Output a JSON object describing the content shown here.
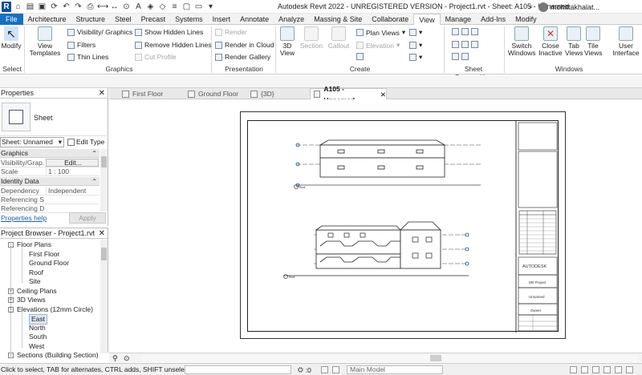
{
  "app": {
    "title": "Autodesk Revit 2022 - UNREGISTERED VERSION - Project1.rvt - Sheet: A105 - Unnamed",
    "user": "mohittakhalat..."
  },
  "ribbon_tabs": [
    "File",
    "Architecture",
    "Structure",
    "Steel",
    "Precast",
    "Systems",
    "Insert",
    "Annotate",
    "Analyze",
    "Massing & Site",
    "Collaborate",
    "View",
    "Manage",
    "Add-Ins",
    "Modify"
  ],
  "active_tab": "View",
  "ribbon": {
    "select": {
      "modify": "Modify",
      "select": "Select"
    },
    "graphics": {
      "label": "Graphics",
      "view_templates": "View Templates",
      "visibility_graphics": "Visibility/ Graphics",
      "filters": "Filters",
      "thin_lines": "Thin Lines",
      "show_hidden_lines": "Show Hidden Lines",
      "remove_hidden_lines": "Remove Hidden Lines",
      "cut_profile": "Cut Profile"
    },
    "presentation": {
      "label": "Presentation",
      "render": "Render",
      "render_in_cloud": "Render in Cloud",
      "render_gallery": "Render Gallery"
    },
    "create": {
      "label": "Create",
      "view_3d": "3D View",
      "section": "Section",
      "callout": "Callout",
      "plan_views": "Plan Views",
      "elevation": "Elevation"
    },
    "sheet_composition": {
      "label": "Sheet Composition"
    },
    "windows": {
      "label": "Windows",
      "switch_windows": "Switch Windows",
      "close_inactive": "Close Inactive",
      "tab_views": "Tab Views",
      "tile_views": "Tile Views",
      "user_interface": "User Interface"
    }
  },
  "properties": {
    "title": "Properties",
    "type_name": "Sheet",
    "instance_selector": "Sheet: Unnamed",
    "edit_type": "Edit Type",
    "groups": [
      {
        "name": "Graphics",
        "rows": [
          {
            "key": "Visibility/Grap...",
            "value": "Edit..."
          },
          {
            "key": "Scale",
            "value": "1 : 100"
          }
        ]
      },
      {
        "name": "Identity Data",
        "rows": [
          {
            "key": "Dependency",
            "value": "Independent"
          },
          {
            "key": "Referencing S...",
            "value": ""
          },
          {
            "key": "Referencing D...",
            "value": ""
          }
        ]
      }
    ],
    "help": "Properties help",
    "apply": "Apply"
  },
  "project_browser": {
    "title": "Project Browser - Project1.rvt",
    "items": [
      {
        "label": "Floor Plans",
        "level": 1,
        "toggle": "-"
      },
      {
        "label": "First Floor",
        "level": 2
      },
      {
        "label": "Ground Floor",
        "level": 2
      },
      {
        "label": "Roof",
        "level": 2
      },
      {
        "label": "Site",
        "level": 2
      },
      {
        "label": "Ceiling Plans",
        "level": 1,
        "toggle": "+"
      },
      {
        "label": "3D Views",
        "level": 1,
        "toggle": "+"
      },
      {
        "label": "Elevations (12mm Circle)",
        "level": 1,
        "toggle": "-"
      },
      {
        "label": "East",
        "level": 2,
        "selected": true
      },
      {
        "label": "North",
        "level": 2
      },
      {
        "label": "South",
        "level": 2
      },
      {
        "label": "West",
        "level": 2
      },
      {
        "label": "Sections (Building Section)",
        "level": 1,
        "toggle": "-"
      }
    ]
  },
  "view_tabs": [
    {
      "label": "First Floor"
    },
    {
      "label": "Ground Floor"
    },
    {
      "label": "{3D}"
    },
    {
      "label": "A105 - Unnamed",
      "active": true
    }
  ],
  "sheet": {
    "elevation_tag_1": "Roof",
    "elevation_tag_2": "Roof",
    "company": "AUTODESK",
    "project": "DB Project",
    "sheet_name": "Unnamed",
    "owner": "Owner"
  },
  "status": {
    "message": "Click to select, TAB for alternates, CTRL adds, SHIFT unselects.",
    "zero": ":0",
    "model": "Main Model"
  }
}
